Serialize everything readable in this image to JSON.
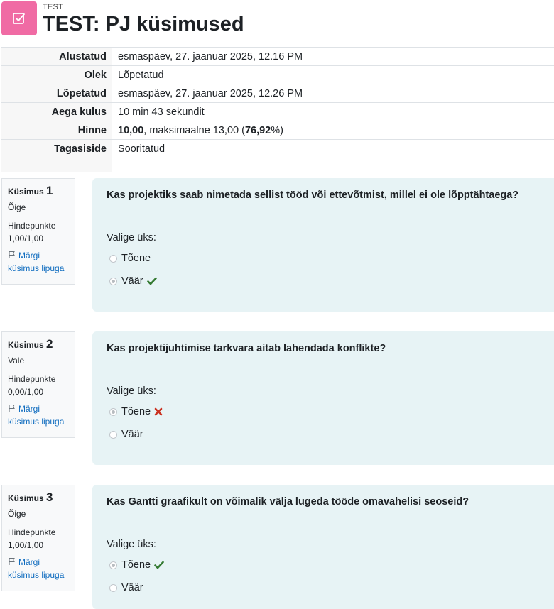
{
  "header": {
    "kicker": "TEST",
    "title": "TEST: PJ küsimused",
    "icon": "quiz-checkbox-icon",
    "icon_color": "#f06ba4"
  },
  "summary": {
    "rows": [
      {
        "label": "Alustatud",
        "value": "esmaspäev, 27. jaanuar 2025, 12.16 PM"
      },
      {
        "label": "Olek",
        "value": "Lõpetatud"
      },
      {
        "label": "Lõpetatud",
        "value": "esmaspäev, 27. jaanuar 2025, 12.26 PM"
      },
      {
        "label": "Aega kulus",
        "value": "10 min 43 sekundit"
      },
      {
        "label": "Hinne",
        "grade": "10,00",
        "grade_mid": ", maksimaalne 13,00 (",
        "percent": "76,92",
        "grade_end": "%)"
      },
      {
        "label": "Tagasiside",
        "value": "Sooritatud"
      }
    ]
  },
  "questions": [
    {
      "label": "Küsimus",
      "number": "1",
      "state": "Õige",
      "grade_label": "Hindepunkte",
      "grade": "1,00/1,00",
      "flag_text": "Märgi küsimus lipuga",
      "text": "Kas projektiks saab nimetada sellist tööd või ettevõtmist, millel ei ole lõpptähtaega?",
      "prompt": "Valige üks:",
      "options": [
        {
          "label": "Tõene",
          "checked": false,
          "mark": ""
        },
        {
          "label": "Väär",
          "checked": true,
          "mark": "correct"
        }
      ]
    },
    {
      "label": "Küsimus",
      "number": "2",
      "state": "Vale",
      "grade_label": "Hindepunkte",
      "grade": "0,00/1,00",
      "flag_text": "Märgi küsimus lipuga",
      "text": "Kas projektijuhtimise tarkvara aitab lahendada konflikte?",
      "prompt": "Valige üks:",
      "options": [
        {
          "label": "Tõene",
          "checked": true,
          "mark": "incorrect"
        },
        {
          "label": "Väär",
          "checked": false,
          "mark": ""
        }
      ]
    },
    {
      "label": "Küsimus",
      "number": "3",
      "state": "Õige",
      "grade_label": "Hindepunkte",
      "grade": "1,00/1,00",
      "flag_text": "Märgi küsimus lipuga",
      "text": "Kas Gantti graafikult on võimalik välja lugeda tööde omavahelisi seoseid?",
      "prompt": "Valige üks:",
      "options": [
        {
          "label": "Tõene",
          "checked": true,
          "mark": "correct"
        },
        {
          "label": "Väär",
          "checked": false,
          "mark": ""
        }
      ]
    }
  ],
  "colors": {
    "correct": "#357a32",
    "incorrect": "#ca3120",
    "link": "#0f6cbf",
    "content_bg": "#e7f3f5"
  }
}
